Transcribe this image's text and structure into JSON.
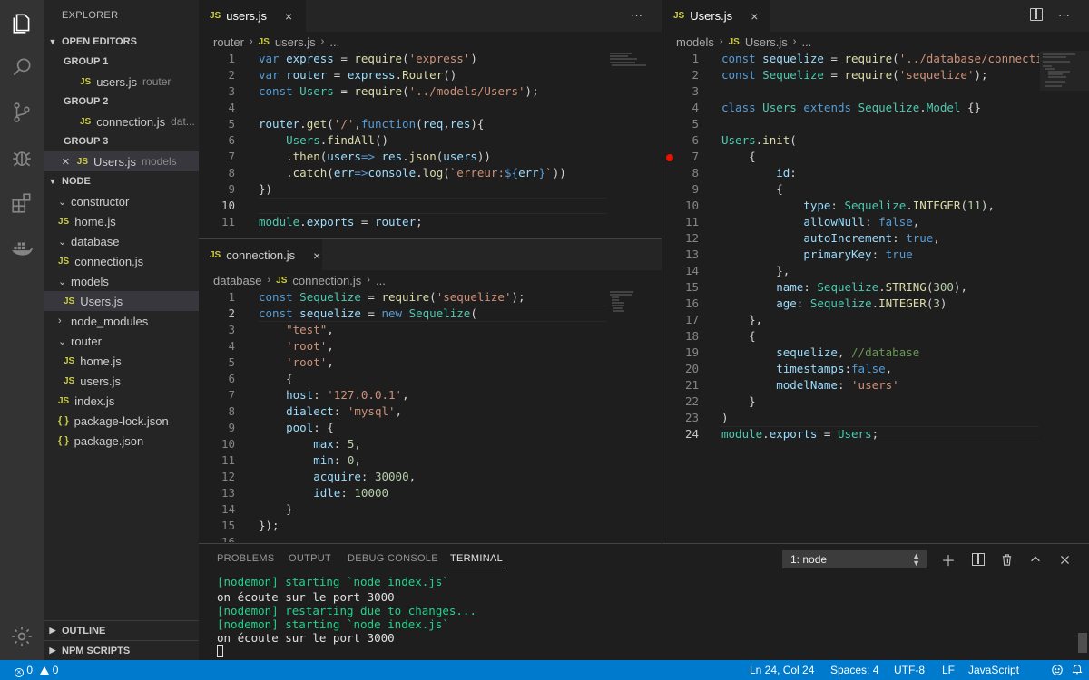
{
  "sidebar": {
    "title": "EXPLORER",
    "open_editors_label": "OPEN EDITORS",
    "groups": [
      {
        "label": "GROUP 1",
        "file": "users.js",
        "desc": "router"
      },
      {
        "label": "GROUP 2",
        "file": "connection.js",
        "desc": "dat..."
      },
      {
        "label": "GROUP 3",
        "file": "Users.js",
        "desc": "models"
      }
    ],
    "project_label": "NODE",
    "tree": [
      {
        "name": "constructor",
        "kind": "folder"
      },
      {
        "name": "home.js",
        "kind": "js"
      },
      {
        "name": "database",
        "kind": "folder"
      },
      {
        "name": "connection.js",
        "kind": "js"
      },
      {
        "name": "models",
        "kind": "folder"
      },
      {
        "name": "Users.js",
        "kind": "js"
      },
      {
        "name": "node_modules",
        "kind": "folder-closed"
      },
      {
        "name": "router",
        "kind": "folder"
      },
      {
        "name": "home.js",
        "kind": "js"
      },
      {
        "name": "users.js",
        "kind": "js"
      },
      {
        "name": "index.js",
        "kind": "js"
      },
      {
        "name": "package-lock.json",
        "kind": "json"
      },
      {
        "name": "package.json",
        "kind": "json"
      }
    ],
    "outline_label": "OUTLINE",
    "npm_label": "NPM SCRIPTS"
  },
  "editor1": {
    "tab": "users.js",
    "crumb_folder": "router",
    "crumb_file": "users.js",
    "crumb_more": "..."
  },
  "editor2": {
    "tab": "connection.js",
    "crumb_folder": "database",
    "crumb_file": "connection.js",
    "crumb_more": "..."
  },
  "editor3": {
    "tab": "Users.js",
    "crumb_folder": "models",
    "crumb_file": "Users.js",
    "crumb_more": "..."
  },
  "icons": {
    "js_badge": "JS",
    "json_badge": "{ }",
    "close": "×",
    "more": "···",
    "chevron_right": "›",
    "chevron_down": "⌄"
  },
  "panel": {
    "tabs": [
      "PROBLEMS",
      "OUTPUT",
      "DEBUG CONSOLE",
      "TERMINAL"
    ],
    "active_tab": "TERMINAL",
    "terminal_select": "1: node",
    "lines": [
      {
        "text": "[nodemon] starting `node index.js`",
        "color": "green"
      },
      {
        "text": "on écoute sur le port 3000",
        "color": "white"
      },
      {
        "text": "[nodemon] restarting due to changes...",
        "color": "green"
      },
      {
        "text": "[nodemon] starting `node index.js`",
        "color": "green"
      },
      {
        "text": "on écoute sur le port 3000",
        "color": "white"
      }
    ]
  },
  "status": {
    "errors": "0",
    "warnings": "0",
    "position": "Ln 24, Col 24",
    "spaces": "Spaces: 4",
    "encoding": "UTF-8",
    "eol": "LF",
    "language": "JavaScript"
  },
  "colors": {
    "accent": "#007acc",
    "keyword": "#569cd6",
    "string": "#ce9178",
    "function": "#dcdcaa",
    "class": "#4ec9b0",
    "number": "#b5cea8",
    "comment": "#6a9955",
    "breakpoint": "#e51400"
  }
}
